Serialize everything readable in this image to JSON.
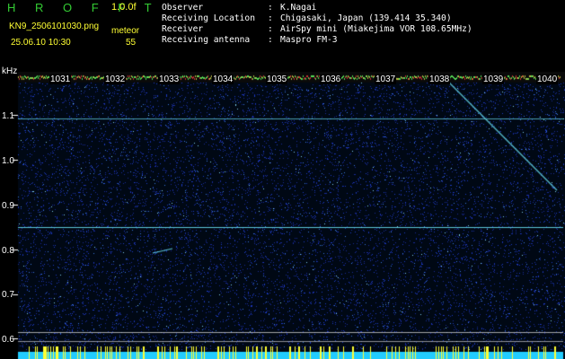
{
  "header": {
    "brand": "H R O F F T",
    "version": "1.0.0f",
    "filename": "KN9_2506101030.png",
    "timestamp": "25.06.10 10:30",
    "meteor_label": "meteor",
    "meteor_count": "55",
    "fields": [
      {
        "key": "Observer",
        "sep": ":",
        "value": "K.Nagai"
      },
      {
        "key": "Receiving Location",
        "sep": ":",
        "value": "Chigasaki, Japan (139.414 35.340)"
      },
      {
        "key": "Receiver",
        "sep": ":",
        "value": "AirSpy mini (Miakejima VOR 108.65MHz)"
      },
      {
        "key": "Receiving antenna",
        "sep": ":",
        "value": "Maspro FM-3"
      }
    ]
  },
  "spectrogram": {
    "y_unit": "kHz",
    "y_ticks": [
      "1.1",
      "1.0",
      "0.9",
      "0.8",
      "0.7",
      "0.6"
    ],
    "x_labels": [
      "1031",
      "1032",
      "1033",
      "1034",
      "1035",
      "1036",
      "1037",
      "1038",
      "1039",
      "1040"
    ]
  },
  "colors": {
    "background": "#000000",
    "brand": "#33cc33",
    "text_yellow": "#ffff33",
    "text_white": "#ffffff",
    "noise_blue": "#1e3cc8",
    "trace_cyan": "#66ddee",
    "baseline_cyan": "#22ccff",
    "marker_yellow": "#ffff33"
  }
}
